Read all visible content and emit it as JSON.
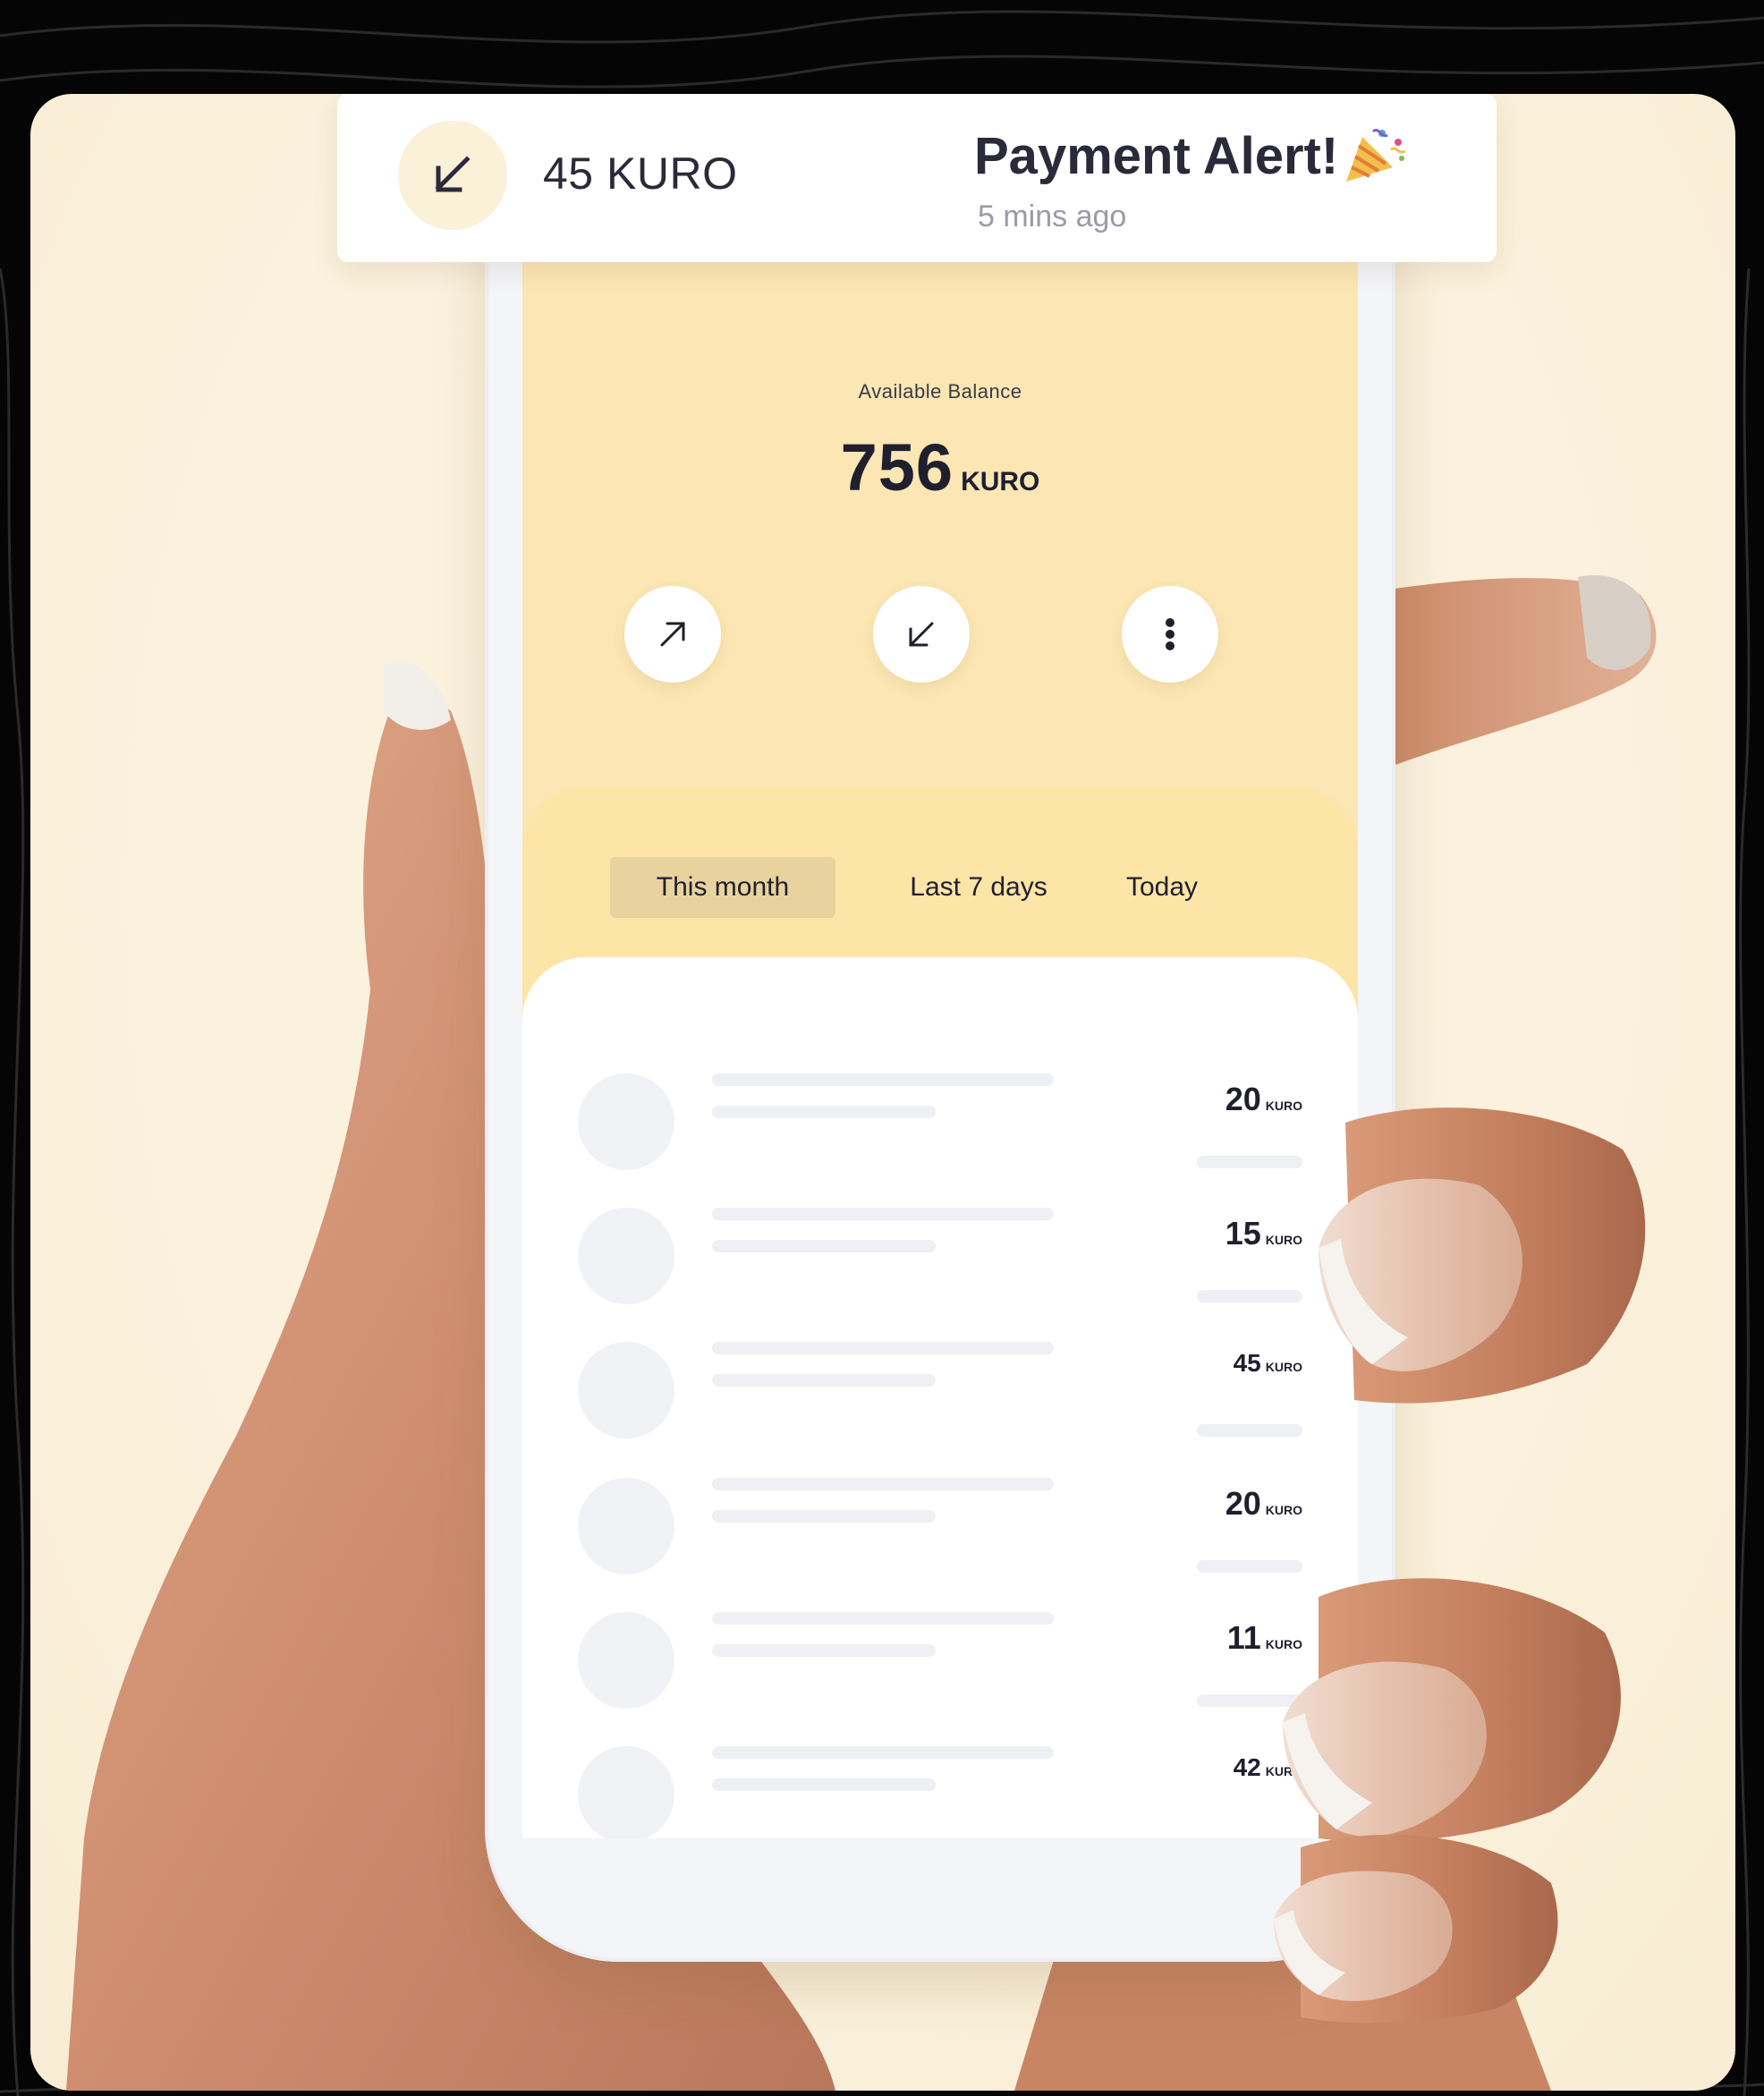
{
  "notification": {
    "amount": "45 KURO",
    "title": "Payment Alert!",
    "time": "5 mins ago",
    "icon": "arrow-down-left-icon",
    "emoji_icon": "party-popper-icon"
  },
  "wallet": {
    "balance_label": "Available Balance",
    "balance_value": "756",
    "balance_unit": "KURO",
    "actions": [
      {
        "name": "send",
        "icon": "arrow-up-right-icon"
      },
      {
        "name": "receive",
        "icon": "arrow-down-left-icon"
      },
      {
        "name": "more",
        "icon": "more-vertical-icon"
      }
    ]
  },
  "tabs": [
    {
      "label": "This month",
      "active": true
    },
    {
      "label": "Last 7 days",
      "active": false
    },
    {
      "label": "Today",
      "active": false
    }
  ],
  "transactions": [
    {
      "amount": "20",
      "unit": "KURO"
    },
    {
      "amount": "15",
      "unit": "KURO"
    },
    {
      "amount": "45",
      "unit": "KURO"
    },
    {
      "amount": "20",
      "unit": "KURO"
    },
    {
      "amount": "11",
      "unit": "KURO"
    },
    {
      "amount": "42",
      "unit": "KURO"
    }
  ],
  "colors": {
    "background": "#050505",
    "card": "#fbf1dc",
    "screen_header": "#fbe6b4",
    "tab_panel": "#fde5a7",
    "active_tab": "#e8d39e",
    "text_dark": "#1f1f2e",
    "skeleton": "#eef0f5"
  }
}
